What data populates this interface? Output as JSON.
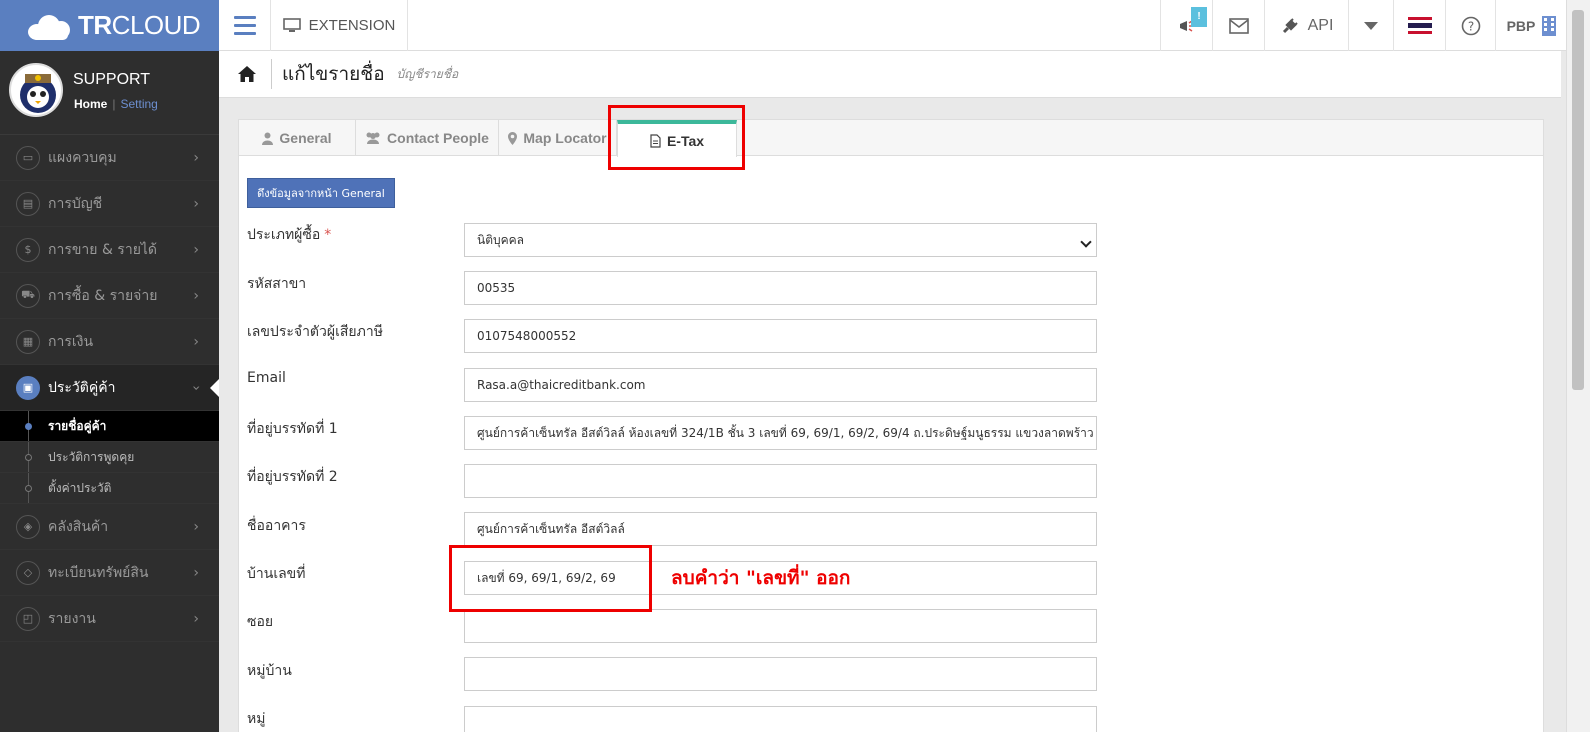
{
  "app": {
    "brand_bold": "TR",
    "brand_rest": "CLOUD"
  },
  "topbar": {
    "extension_label": "EXTENSION",
    "notify_count": "!",
    "api_label": "API",
    "user_label": "PBP"
  },
  "profile": {
    "name": "SUPPORT",
    "home": "Home",
    "separator": "|",
    "setting": "Setting"
  },
  "sidebar": {
    "items": [
      {
        "label": "แผงควบคุม",
        "icon": "monitor-icon"
      },
      {
        "label": "การบัญชี",
        "icon": "book-icon"
      },
      {
        "label": "การขาย & รายได้",
        "icon": "dollar-icon"
      },
      {
        "label": "การซื้อ & รายจ่าย",
        "icon": "cart-icon"
      },
      {
        "label": "การเงิน",
        "icon": "calendar-icon"
      },
      {
        "label": "ประวัติคู่ค้า",
        "icon": "contact-book-icon"
      },
      {
        "label": "คลังสินค้า",
        "icon": "boxes-icon"
      },
      {
        "label": "ทะเบียนทรัพย์สิน",
        "icon": "diamond-icon"
      },
      {
        "label": "รายงาน",
        "icon": "report-icon"
      }
    ],
    "sub_items": [
      {
        "label": "รายชื่อคู่ค้า"
      },
      {
        "label": "ประวัติการพูดคุย"
      },
      {
        "label": "ตั้งค่าประวัติ"
      }
    ]
  },
  "page": {
    "title": "แก้ไขรายชื่อ",
    "subtitle": "บัญชีรายชื่อ"
  },
  "tabs": [
    {
      "label": "General",
      "icon": "user-icon"
    },
    {
      "label": "Contact People",
      "icon": "users-icon"
    },
    {
      "label": "Map Locator",
      "icon": "map-marker-icon"
    },
    {
      "label": "E-Tax",
      "icon": "file-icon"
    }
  ],
  "form": {
    "pull_button": "ดึงข้อมูลจากหน้า General",
    "fields": [
      {
        "label": "ประเภทผู้ซื้อ",
        "required": "*",
        "value": "นิติบุคคล"
      },
      {
        "label": "รหัสสาขา",
        "value": "00535"
      },
      {
        "label": "เลขประจำตัวผู้เสียภาษี",
        "value": "0107548000552"
      },
      {
        "label": "Email",
        "value": "Rasa.a@thaicreditbank.com"
      },
      {
        "label": "ที่อยู่บรรทัดที่ 1",
        "value": "ศูนย์การค้าเซ็นทรัล อีสต์วิลล์ ห้องเลขที่ 324/1B ชั้น 3 เลขที่ 69, 69/1, 69/2, 69/4 ถ.ประดิษฐ์มนูธรรม แขวงลาดพร้าว"
      },
      {
        "label": "ที่อยู่บรรทัดที่ 2",
        "value": ""
      },
      {
        "label": "ชื่ออาคาร",
        "value": "ศูนย์การค้าเซ็นทรัล อีสต์วิลล์"
      },
      {
        "label": "บ้านเลขที่",
        "value": "เลขที่ 69, 69/1, 69/2, 69"
      },
      {
        "label": "ซอย",
        "value": ""
      },
      {
        "label": "หมู่บ้าน",
        "value": ""
      },
      {
        "label": "หมู่",
        "value": ""
      }
    ]
  },
  "annotation": {
    "note": "ลบคำว่า \"เลขที่\" ออก"
  },
  "colors": {
    "brand": "#5a7fc0",
    "accent_tab": "#3cb89a",
    "annotation": "#ee0000"
  }
}
